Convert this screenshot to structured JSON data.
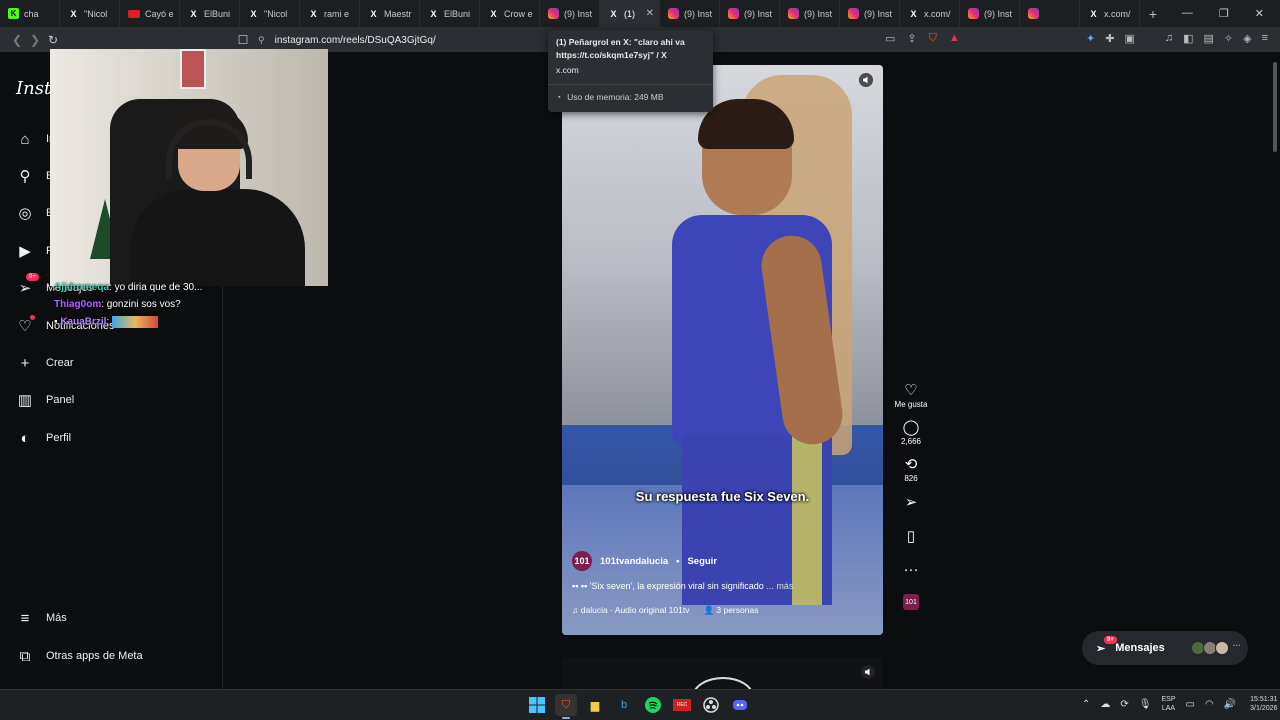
{
  "tabs": [
    {
      "icon": "kick-icon",
      "title": "cha",
      "type": "kick"
    },
    {
      "icon": "x-icon",
      "title": "\"Nicol",
      "type": "x"
    },
    {
      "icon": "youtube-icon",
      "title": "Cayó e",
      "type": "yt"
    },
    {
      "icon": "x-icon",
      "title": "ElBuni",
      "type": "x"
    },
    {
      "icon": "x-icon",
      "title": "\"Nicol",
      "type": "x"
    },
    {
      "icon": "x-icon",
      "title": "rami e",
      "type": "x"
    },
    {
      "icon": "x-icon",
      "title": "Maestr",
      "type": "x"
    },
    {
      "icon": "x-icon",
      "title": "ElBuni",
      "type": "x"
    },
    {
      "icon": "x-icon",
      "title": "Crow e",
      "type": "x"
    },
    {
      "icon": "instagram-icon",
      "title": "(9) Inst",
      "type": "ig"
    },
    {
      "icon": "x-icon",
      "title": "(1)",
      "type": "x",
      "active": true
    },
    {
      "icon": "instagram-icon",
      "title": "(9) Inst",
      "type": "ig"
    },
    {
      "icon": "instagram-icon",
      "title": "(9) Inst",
      "type": "ig"
    },
    {
      "icon": "instagram-icon",
      "title": "(9) Inst",
      "type": "ig"
    },
    {
      "icon": "instagram-icon",
      "title": "(9) Inst",
      "type": "ig"
    },
    {
      "icon": "x-icon",
      "title": "x.com/",
      "type": "x"
    },
    {
      "icon": "instagram-icon",
      "title": "(9) Inst",
      "type": "ig"
    },
    {
      "icon": "instagram-icon",
      "title": "",
      "type": "ig"
    },
    {
      "icon": "x-icon",
      "title": "x.com/",
      "type": "x"
    }
  ],
  "address": {
    "url": "instagram.com/reels/DSuQA3GjtGq/"
  },
  "tooltip": {
    "title": "(1) Peñargrol en X: \"claro ahi va https://t.co/skqm1e7syj\" / X",
    "domain": "x.com",
    "memory": "Uso de memoria: 249 MB"
  },
  "sidebar": {
    "logo": "Insta",
    "items": [
      {
        "label": "In",
        "icon": "home-icon"
      },
      {
        "label": "B",
        "icon": "search-icon"
      },
      {
        "label": "E",
        "icon": "explore-icon"
      },
      {
        "label": "R",
        "icon": "reels-icon"
      },
      {
        "label": "Mensajes",
        "icon": "messenger-icon",
        "badge": "9+"
      },
      {
        "label": "Notificaciones",
        "icon": "heart-icon"
      },
      {
        "label": "Crear",
        "icon": "plus-icon"
      },
      {
        "label": "Panel",
        "icon": "dashboard-icon"
      },
      {
        "label": "Perfil",
        "icon": "profile-icon"
      },
      {
        "label": "Más",
        "icon": "menu-icon"
      },
      {
        "label": "Otras apps de Meta",
        "icon": "meta-apps-icon"
      }
    ]
  },
  "chat": [
    {
      "user": "Ajjdromeqa",
      "text": ": yo diria que de 30..."
    },
    {
      "user": "Thiag0om",
      "text": ": gonzini sos vos?"
    },
    {
      "user": "KauaBrzil",
      "text": ":"
    }
  ],
  "reel": {
    "caption": "Su respuesta fue Six Seven.",
    "avatar_text": "101",
    "account": "101tvandalucia",
    "follow": "Seguir",
    "description": "'Six seven', la expresión viral sin significado",
    "more": "... más",
    "audio": "dalucia · Audio original  101tv",
    "people": "3 personas"
  },
  "actions": {
    "like": "Me gusta",
    "comments": "2,666",
    "reposts": "826"
  },
  "messages_pill": {
    "label": "Mensajes",
    "badge": "9+"
  },
  "taskbar": {
    "lang_top": "ESP",
    "lang_bottom": "LAA",
    "time": "15:51:31",
    "date": "3/1/2026"
  }
}
